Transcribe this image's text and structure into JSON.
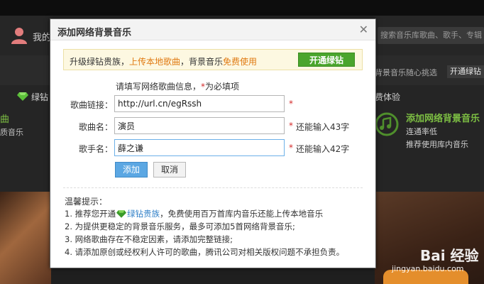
{
  "background": {
    "mine_label": "我的",
    "search_placeholder": "搜索音乐库歌曲、歌手、专辑",
    "right_text": "背景音乐随心挑选",
    "open_button": "开通绿钻",
    "left_vip": "绿钻",
    "left_song": "曲",
    "left_quality": "质音乐",
    "right_experience": "费体验",
    "right_title": "添加网络背景音乐",
    "right_line1": "连通率低",
    "right_line2": "推荐使用库内音乐"
  },
  "dialog": {
    "title": "添加网络背景音乐",
    "close_glyph": "✕",
    "promo": {
      "prefix": "升级绿钻贵族，",
      "upload_link": "上传本地歌曲",
      "middle": "，背景音乐",
      "free_link": "免费使用",
      "button": "开通绿钻"
    },
    "hint_prefix": "请填写网络歌曲信息，",
    "hint_star": "*",
    "hint_suffix": "为必填项",
    "fields": [
      {
        "label": "歌曲链接：",
        "value": "http://url.cn/egRssh",
        "star": "*",
        "remain": ""
      },
      {
        "label": "歌曲名：",
        "value": "演员",
        "star": "*",
        "remain": "还能输入43字"
      },
      {
        "label": "歌手名：",
        "value": "薛之谦",
        "star": "*",
        "remain": "还能输入42字"
      }
    ],
    "add_button": "添加",
    "cancel_button": "取消",
    "tips": {
      "title": "温馨提示：",
      "line1_prefix": "1. 推荐您开通",
      "line1_vip": "绿钻贵族",
      "line1_suffix": "，免费使用百万首库内音乐还能上传本地音乐",
      "line2": "2. 为提供更稳定的背景音乐服务，最多可添加5首网络背景音乐;",
      "line3": "3. 网络歌曲存在不稳定因素，请添加完整链接;",
      "line4": "4. 请添加原创或经权利人许可的歌曲，腾讯公司对相关版权问题不承担负责。"
    }
  },
  "watermark": {
    "logo": "Bai 经验",
    "url": "jingyan.baidu.com"
  },
  "colors": {
    "accent_green": "#4aa52d",
    "link_orange": "#e07a12",
    "required_red": "#d42b2b",
    "add_blue": "#5ba7e3"
  }
}
